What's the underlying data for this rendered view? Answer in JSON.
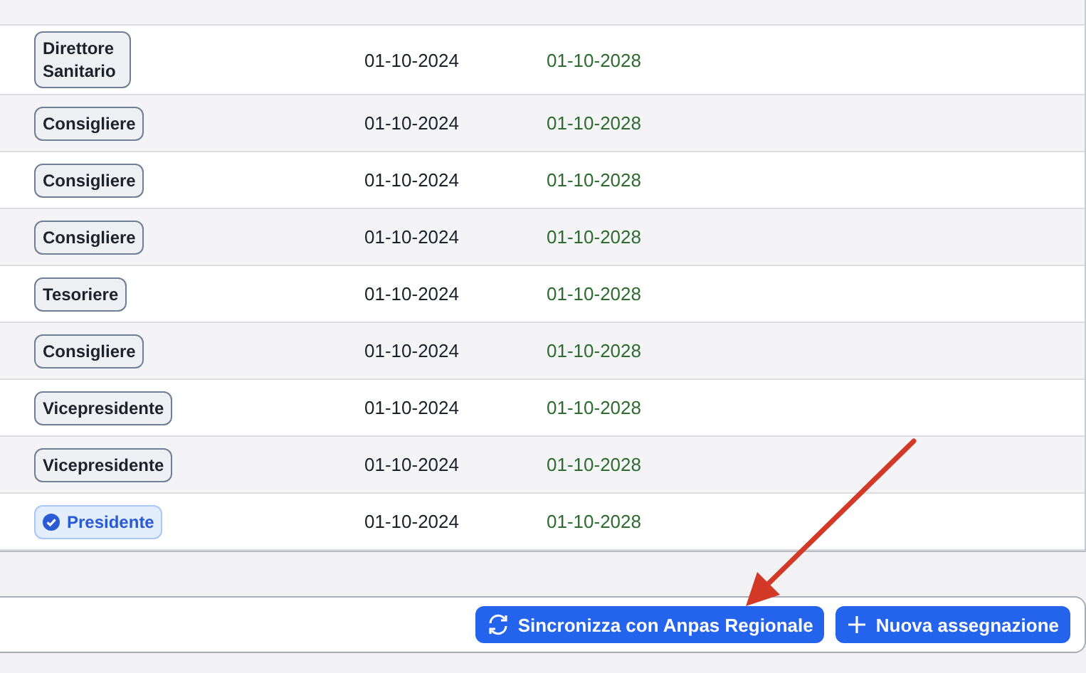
{
  "table": {
    "rows": [
      {
        "role": "Direttore Sanitario",
        "start": "01-10-2024",
        "end": "01-10-2028",
        "selected": false
      },
      {
        "role": "Consigliere",
        "start": "01-10-2024",
        "end": "01-10-2028",
        "selected": false
      },
      {
        "role": "Consigliere",
        "start": "01-10-2024",
        "end": "01-10-2028",
        "selected": false
      },
      {
        "role": "Consigliere",
        "start": "01-10-2024",
        "end": "01-10-2028",
        "selected": false
      },
      {
        "role": "Tesoriere",
        "start": "01-10-2024",
        "end": "01-10-2028",
        "selected": false
      },
      {
        "role": "Consigliere",
        "start": "01-10-2024",
        "end": "01-10-2028",
        "selected": false
      },
      {
        "role": "Vicepresidente",
        "start": "01-10-2024",
        "end": "01-10-2028",
        "selected": false
      },
      {
        "role": "Vicepresidente",
        "start": "01-10-2024",
        "end": "01-10-2028",
        "selected": false
      },
      {
        "role": "Presidente",
        "start": "01-10-2024",
        "end": "01-10-2028",
        "selected": true
      }
    ]
  },
  "footer": {
    "buttons": [
      {
        "kind": "sync",
        "label": "Sincronizza con Anpas Regionale"
      },
      {
        "kind": "add",
        "label": "Nuova assegnazione"
      }
    ]
  }
}
